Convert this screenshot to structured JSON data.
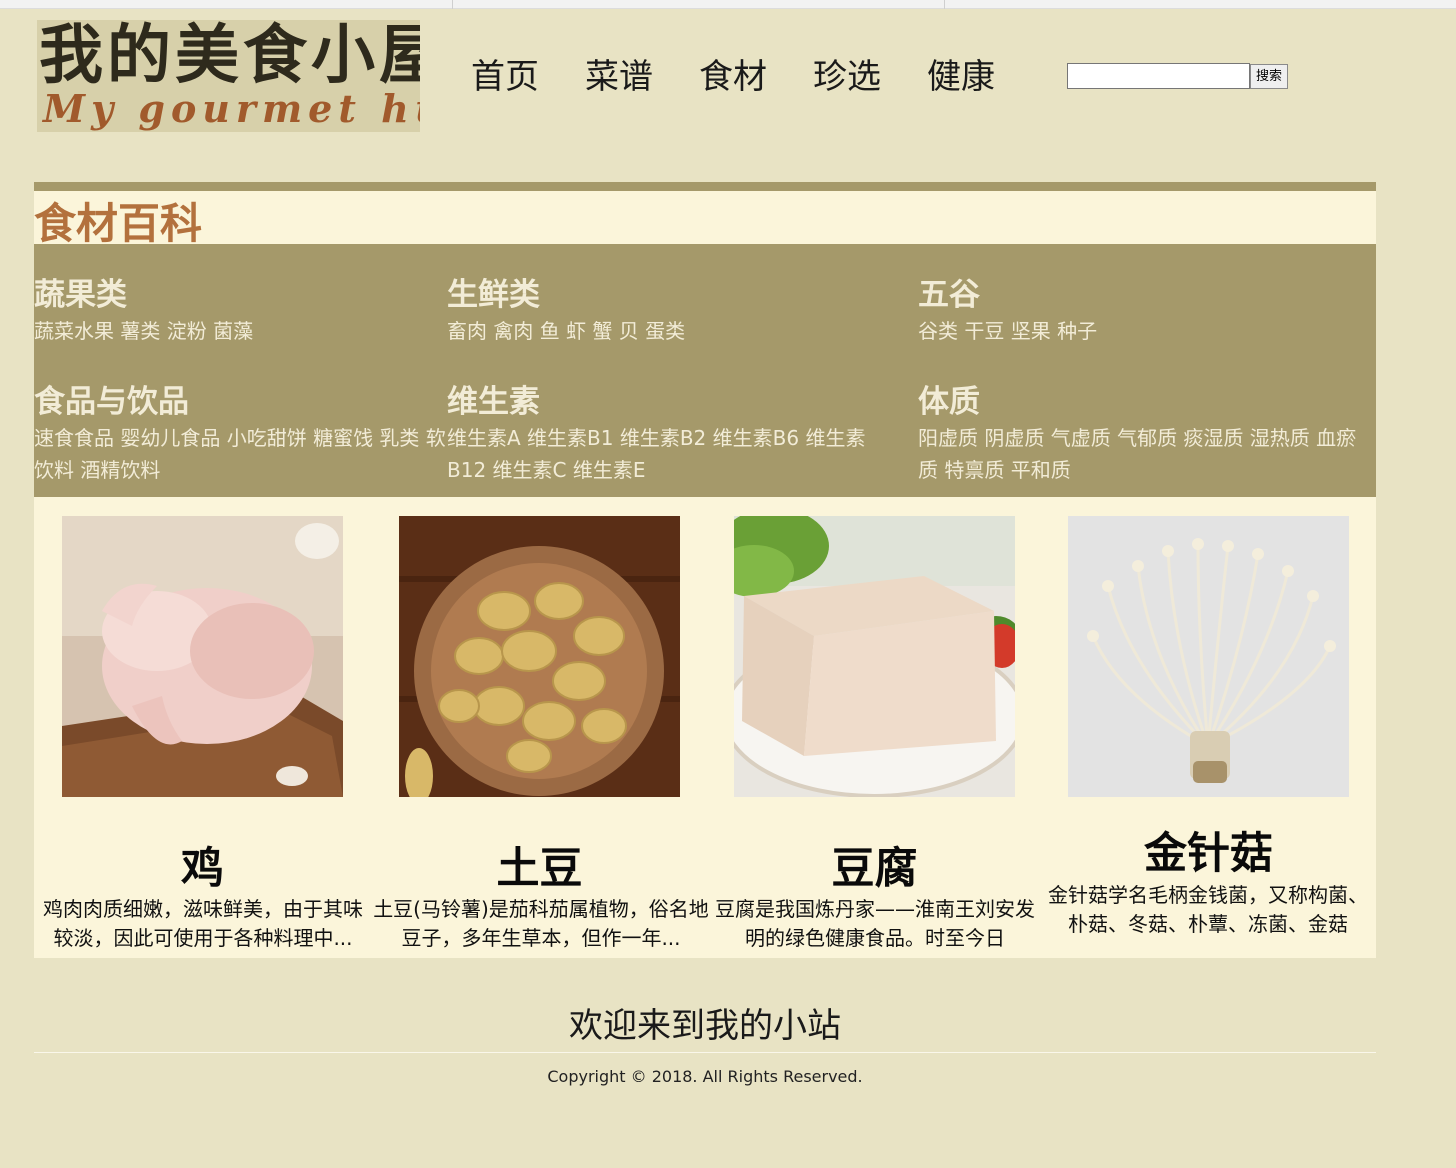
{
  "logo": {
    "cn": "我的美食小屋",
    "en": "My gourmet hut"
  },
  "nav": [
    "首页",
    "菜谱",
    "食材",
    "珍选",
    "健康"
  ],
  "search": {
    "button_label": "搜索",
    "value": ""
  },
  "section_title": "食材百科",
  "categories": [
    {
      "title": "蔬果类",
      "items": "蔬菜水果 薯类 淀粉 菌藻"
    },
    {
      "title": "生鲜类",
      "items": "畜肉 禽肉 鱼 虾 蟹 贝 蛋类"
    },
    {
      "title": "五谷",
      "items": "谷类 干豆 坚果 种子"
    },
    {
      "title": "食品与饮品",
      "items": "速食食品 婴幼儿食品 小吃甜饼 糖蜜饯 乳类 软饮料 酒精饮料"
    },
    {
      "title": "维生素",
      "items": "维生素A 维生素B1 维生素B2 维生素B6 维生素B12 维生素C 维生素E"
    },
    {
      "title": "体质",
      "items": "阳虚质 阴虚质 气虚质 气郁质 痰湿质 湿热质 血瘀质 特禀质 平和质"
    }
  ],
  "foods": [
    {
      "name": "鸡",
      "desc": "鸡肉肉质细嫩，滋味鲜美，由于其味较淡，因此可使用于各种料理中..."
    },
    {
      "name": "土豆",
      "desc": "土豆(马铃薯)是茄科茄属植物，俗名地豆子，多年生草本，但作一年..."
    },
    {
      "name": "豆腐",
      "desc": "豆腐是我国炼丹家——淮南王刘安发明的绿色健康食品。时至今日"
    },
    {
      "name": "金针菇",
      "desc": "金针菇学名毛柄金钱菌，又称构菌、朴菇、冬菇、朴蕈、冻菌、金菇"
    }
  ],
  "footer": {
    "welcome": "欢迎来到我的小站",
    "copyright": "Copyright © 2018. All Rights Reserved."
  },
  "colors": {
    "background": "#e8e3c4",
    "panel": "#fbf5da",
    "category_band": "#a5996a",
    "title_accent": "#b3713d"
  }
}
